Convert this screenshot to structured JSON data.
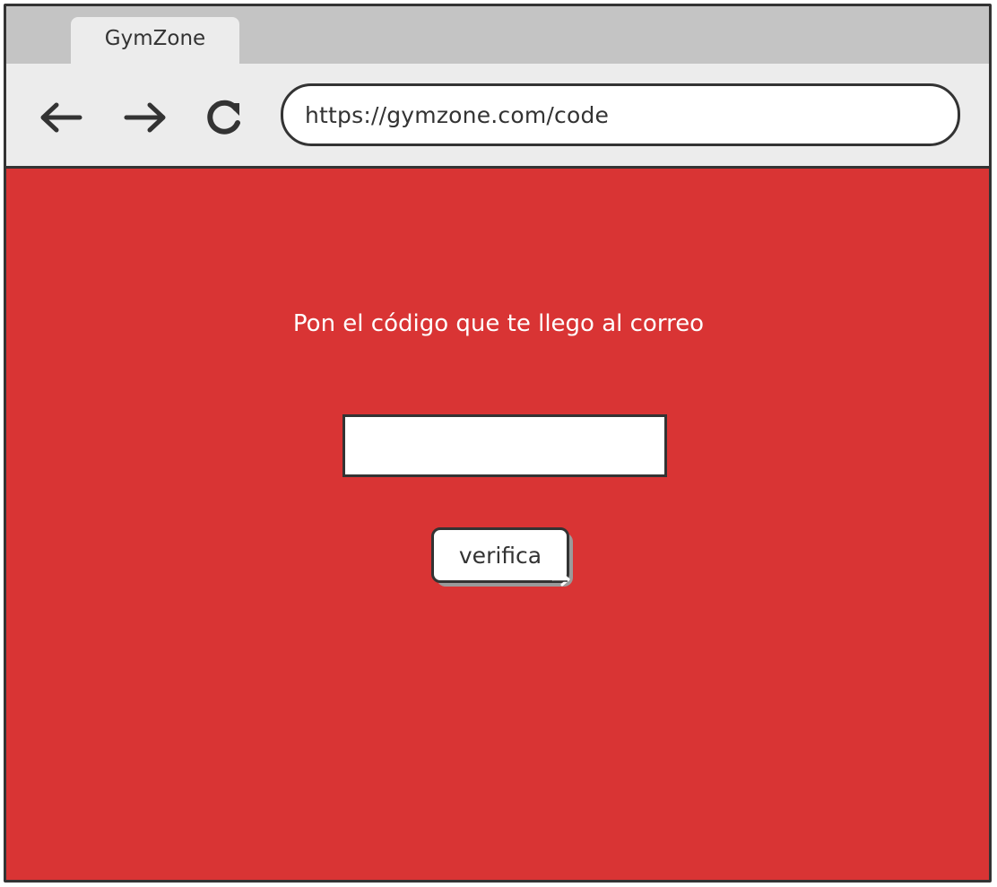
{
  "browser": {
    "tab_title": "GymZone",
    "url": "https://gymzone.com/code",
    "icons": {
      "back": "arrow-left-icon",
      "forward": "arrow-right-icon",
      "reload": "reload-icon"
    }
  },
  "page": {
    "prompt": "Pon el código que te llego al correo",
    "code_input_value": "",
    "verify_button_label": "verifica"
  },
  "colors": {
    "background": "#d93434",
    "toolbar": "#ececec",
    "tabstrip": "#c4c4c4",
    "outline": "#333333"
  }
}
